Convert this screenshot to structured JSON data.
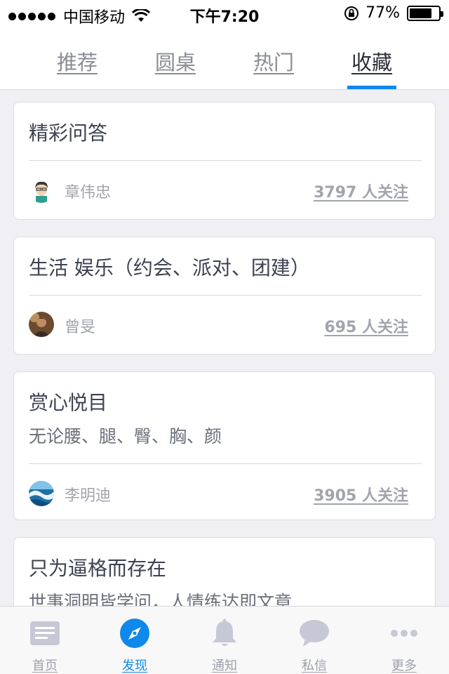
{
  "status_bar": {
    "carrier": "中国移动",
    "time": "下午7:20",
    "battery": "77%",
    "battery_level": 0.77
  },
  "top_tabs": [
    {
      "label": "推荐",
      "active": false
    },
    {
      "label": "圆桌",
      "active": false
    },
    {
      "label": "热门",
      "active": false
    },
    {
      "label": "收藏",
      "active": true
    }
  ],
  "collections": [
    {
      "title": "精彩问答",
      "description": "",
      "author": "章伟忠",
      "followers": "3797 人关注",
      "avatar": "cartoon-face"
    },
    {
      "title": "生活 娱乐（约会、派对、团建）",
      "description": "",
      "author": "曾旻",
      "followers": "695 人关注",
      "avatar": "photo-person"
    },
    {
      "title": "赏心悦目",
      "description": "无论腰、腿、臀、胸、颜",
      "author": "李明迪",
      "followers": "3905 人关注",
      "avatar": "ocean-wave"
    },
    {
      "title": "只为逼格而存在",
      "description": "世事洞明皆学问，人情练达即文章",
      "author": "",
      "followers": "",
      "avatar": ""
    }
  ],
  "bottom_tabs": [
    {
      "label": "首页",
      "icon": "document-icon",
      "active": false
    },
    {
      "label": "发现",
      "icon": "compass-icon",
      "active": true
    },
    {
      "label": "通知",
      "icon": "bell-icon",
      "active": false
    },
    {
      "label": "私信",
      "icon": "chat-bubble-icon",
      "active": false
    },
    {
      "label": "更多",
      "icon": "more-dots-icon",
      "active": false
    }
  ],
  "colors": {
    "accent": "#0f88eb",
    "inactive_icon": "#c7c8d6",
    "background": "#efeff4"
  }
}
